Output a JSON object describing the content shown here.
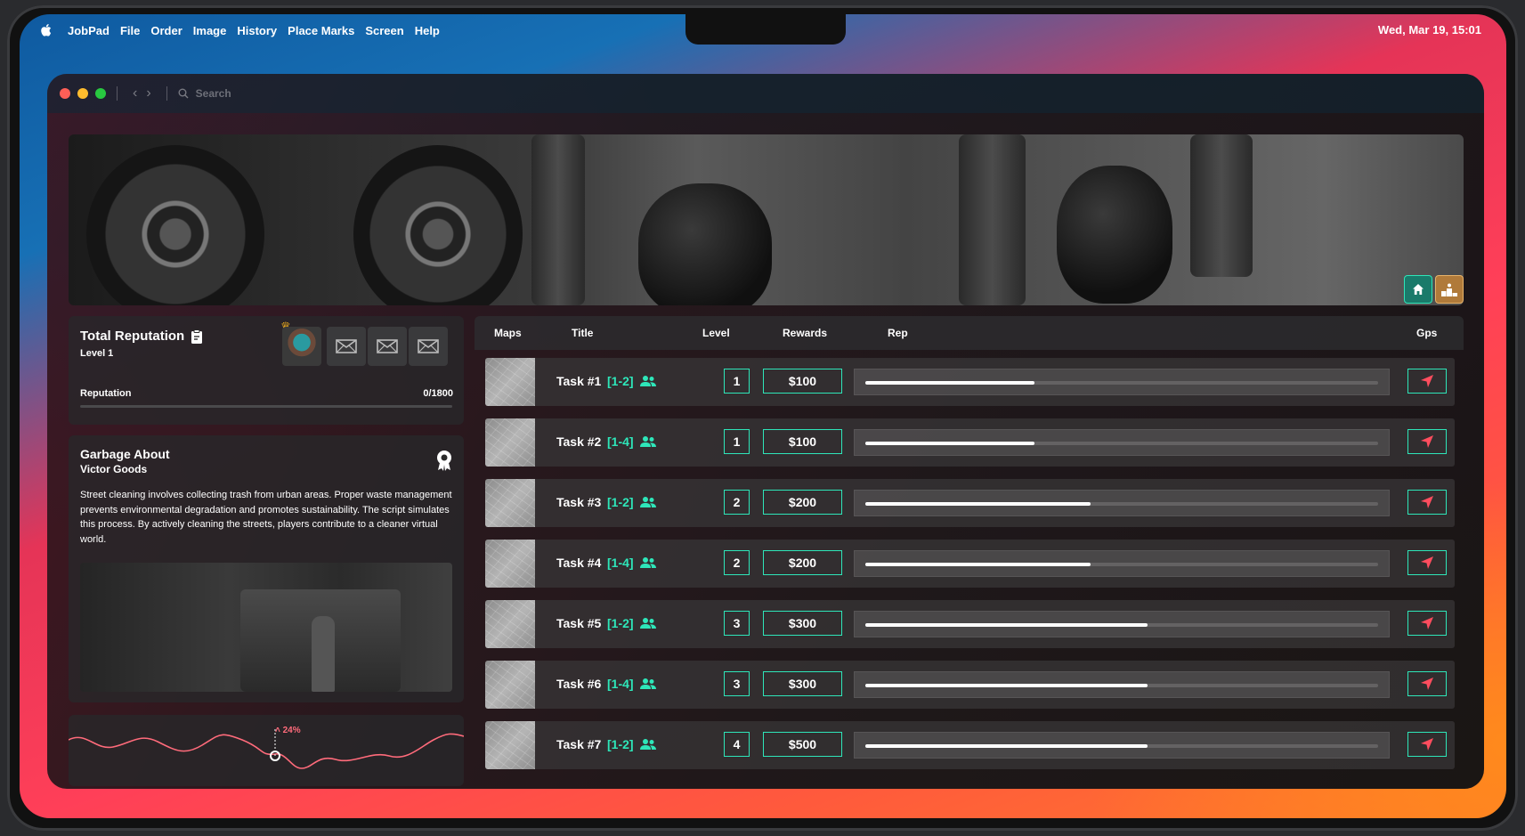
{
  "menubar": {
    "brand": "JobPad",
    "items": [
      "File",
      "Order",
      "Image",
      "History",
      "Place Marks",
      "Screen",
      "Help"
    ],
    "clock": "Wed, Mar 19, 15:01"
  },
  "window": {
    "search_placeholder": "Search"
  },
  "reputation": {
    "title": "Total Reputation",
    "level": "Level 1",
    "label": "Reputation",
    "value": "0/1800",
    "progress_fraction": 0
  },
  "about": {
    "title": "Garbage About",
    "subtitle": "Victor Goods",
    "text": "Street cleaning involves collecting trash from urban areas. Proper waste management prevents environmental degradation and promotes sustainability. The script simulates this process. By actively cleaning the streets, players contribute to a cleaner virtual world."
  },
  "graph": {
    "percent": "24%"
  },
  "table": {
    "headers": {
      "maps": "Maps",
      "title": "Title",
      "level": "Level",
      "rewards": "Rewards",
      "rep": "Rep",
      "gps": "Gps"
    },
    "rows": [
      {
        "name": "Task #1",
        "players": "[1-2]",
        "level": "1",
        "reward": "$100",
        "rep_fraction": 0.33
      },
      {
        "name": "Task #2",
        "players": "[1-4]",
        "level": "1",
        "reward": "$100",
        "rep_fraction": 0.33
      },
      {
        "name": "Task #3",
        "players": "[1-2]",
        "level": "2",
        "reward": "$200",
        "rep_fraction": 0.44
      },
      {
        "name": "Task #4",
        "players": "[1-4]",
        "level": "2",
        "reward": "$200",
        "rep_fraction": 0.44
      },
      {
        "name": "Task #5",
        "players": "[1-2]",
        "level": "3",
        "reward": "$300",
        "rep_fraction": 0.55
      },
      {
        "name": "Task #6",
        "players": "[1-4]",
        "level": "3",
        "reward": "$300",
        "rep_fraction": 0.55
      },
      {
        "name": "Task #7",
        "players": "[1-2]",
        "level": "4",
        "reward": "$500",
        "rep_fraction": 0.55
      }
    ]
  },
  "colors": {
    "accent": "#2ee6b9",
    "gps_arrow": "#ff4d5e"
  }
}
